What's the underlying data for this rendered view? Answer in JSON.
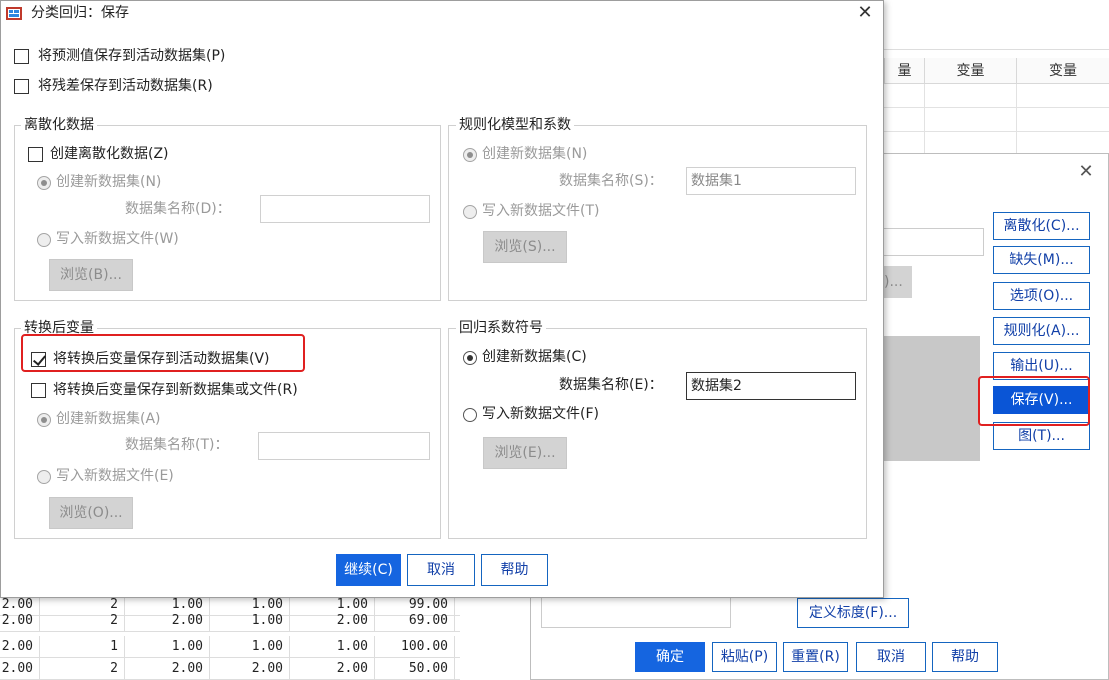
{
  "dialog": {
    "title": "分类回归：保存",
    "close_glyph": "✕",
    "save_predicted": "将预测值保存到活动数据集(P)",
    "save_residuals": "将残差保存到活动数据集(R)",
    "discretize": {
      "title": "离散化数据",
      "create_label": "创建离散化数据(Z)",
      "new_dataset": "创建新数据集(N)",
      "dataset_name_label": "数据集名称(D)：",
      "dataset_name_value": "",
      "write_file": "写入新数据文件(W)",
      "browse": "浏览(B)..."
    },
    "regularize": {
      "title": "规则化模型和系数",
      "new_dataset": "创建新数据集(N)",
      "dataset_name_label": "数据集名称(S)：",
      "dataset_name_value": "数据集1",
      "write_file": "写入新数据文件(T)",
      "browse": "浏览(S)..."
    },
    "transformed": {
      "title": "转换后变量",
      "save_active": "将转换后变量保存到活动数据集(V)",
      "save_new": "将转换后变量保存到新数据集或文件(R)",
      "new_dataset": "创建新数据集(A)",
      "dataset_name_label": "数据集名称(T)：",
      "dataset_name_value": "",
      "write_file": "写入新数据文件(E)",
      "browse": "浏览(O)..."
    },
    "coef": {
      "title": "回归系数符号",
      "new_dataset": "创建新数据集(C)",
      "dataset_name_label": "数据集名称(E)：",
      "dataset_name_value": "数据集2",
      "write_file": "写入新数据文件(F)",
      "browse": "浏览(E)..."
    },
    "buttons": {
      "continue": "继续(C)",
      "cancel": "取消",
      "help": "帮助"
    }
  },
  "bg_dialog": {
    "close_glyph": "✕",
    "side_buttons": [
      "离散化(C)...",
      "缺失(M)...",
      "选项(O)...",
      "规则化(A)...",
      "输出(U)...",
      "保存(V)...",
      "图(T)..."
    ],
    "partial_text": ")...",
    "define_scale": "定义标度(F)...",
    "bottom_buttons": {
      "ok": "确定",
      "paste": "粘贴(P)",
      "reset": "重置(R)",
      "cancel": "取消",
      "help": "帮助"
    }
  },
  "sheet": {
    "headers": [
      "量",
      "变量",
      "变量"
    ],
    "rows": [
      [
        "2.00",
        "2",
        "1.00",
        "1.00",
        "1.00",
        "99.00"
      ],
      [
        "2.00",
        "2",
        "2.00",
        "1.00",
        "2.00",
        "69.00"
      ],
      [
        "2.00",
        "1",
        "1.00",
        "1.00",
        "1.00",
        "100.00"
      ],
      [
        "2.00",
        "2",
        "2.00",
        "2.00",
        "2.00",
        "50.00"
      ]
    ]
  },
  "colors": {
    "accent": "#1565e0",
    "highlight": "#e02020"
  }
}
